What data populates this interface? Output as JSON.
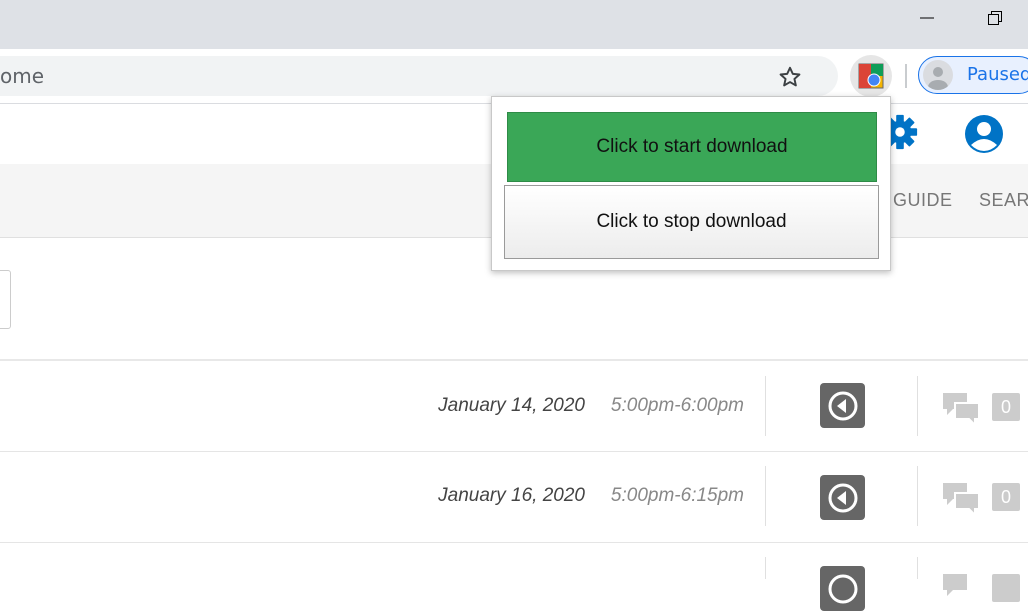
{
  "browser": {
    "omnibox_text": "ome",
    "profile_label": "Paused",
    "window_buttons": [
      "minimize-icon",
      "restore-icon"
    ],
    "icons": [
      "star-icon",
      "extension-icon",
      "avatar-icon"
    ]
  },
  "site": {
    "nav": {
      "guide": "GUIDE",
      "search": "SEAR"
    },
    "header_icons": [
      "gear-icon",
      "user-icon"
    ],
    "accent_color": "#0073c6",
    "rows": [
      {
        "date": "January 14, 2020",
        "time": "5:00pm-6:00pm",
        "comments": "0"
      },
      {
        "date": "January 16, 2020",
        "time": "5:00pm-6:15pm",
        "comments": "0"
      }
    ]
  },
  "popup": {
    "start_label": "Click to start download",
    "stop_label": "Click to stop download",
    "start_color": "#3aa757"
  }
}
